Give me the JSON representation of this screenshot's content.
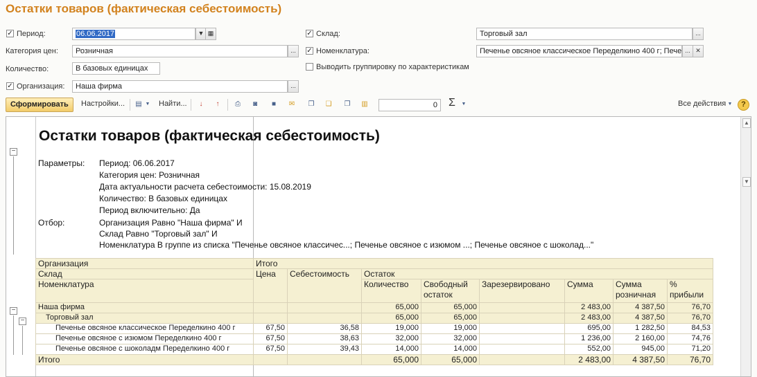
{
  "title": "Остатки товаров (фактическая себестоимость)",
  "form": {
    "period_label": "Период:",
    "period_value": "06.06.2017",
    "price_category_label": "Категория цен:",
    "price_category_value": "Розничная",
    "quantity_label": "Количество:",
    "quantity_value": "В базовых единицах",
    "organization_label": "Организация:",
    "organization_value": "Наша фирма",
    "warehouse_label": "Склад:",
    "warehouse_value": "Торговый зал",
    "nomenclature_label": "Номенклатура:",
    "nomenclature_value": "Печенье овсяное классическое Переделкино 400 г; Пече",
    "group_by_chars_label": "Выводить группировку по характеристикам"
  },
  "toolbar": {
    "generate": "Сформировать",
    "settings": "Настройки...",
    "find": "Найти...",
    "number_value": "0",
    "sigma": "Σ",
    "all_actions": "Все действия",
    "help": "?"
  },
  "report": {
    "title": "Остатки товаров (фактическая себестоимость)",
    "params_label": "Параметры:",
    "params": [
      "Период: 06.06.2017",
      "Категория цен: Розничная",
      "Дата актуальности расчета себестоимости: 15.08.2019",
      "Количество: В базовых единицах",
      "Период включительно: Да"
    ],
    "filter_label": "Отбор:",
    "filters": [
      "Организация Равно \"Наша фирма\" И",
      "Склад Равно \"Торговый зал\" И",
      "Номенклатура В группе из списка \"Печенье овсяное классичес...; Печенье овсяное с изюмом ...; Печенье овсяное с шоколад...\""
    ],
    "headers": {
      "organization": "Организация",
      "total": "Итого",
      "warehouse": "Склад",
      "price": "Цена",
      "cost": "Себестоимость",
      "balance": "Остаток",
      "nomenclature": "Номенклатура",
      "quantity": "Количество",
      "free_balance": "Свободный остаток",
      "reserved": "Зарезервировано",
      "sum": "Сумма",
      "retail_sum": "Сумма розничная",
      "profit_pct": "% прибыли"
    },
    "rows": [
      {
        "name": "Наша фирма",
        "price": "",
        "cost": "",
        "qty": "65,000",
        "free": "65,000",
        "reserved": "",
        "sum": "2 483,00",
        "retail": "4 387,50",
        "profit": "76,70"
      },
      {
        "name": "Торговый зал",
        "price": "",
        "cost": "",
        "qty": "65,000",
        "free": "65,000",
        "reserved": "",
        "sum": "2 483,00",
        "retail": "4 387,50",
        "profit": "76,70"
      },
      {
        "name": "Печенье овсяное классическое Переделкино 400 г",
        "price": "67,50",
        "cost": "36,58",
        "qty": "19,000",
        "free": "19,000",
        "reserved": "",
        "sum": "695,00",
        "retail": "1 282,50",
        "profit": "84,53"
      },
      {
        "name": "Печенье овсяное с изюмом Переделкино 400 г",
        "price": "67,50",
        "cost": "38,63",
        "qty": "32,000",
        "free": "32,000",
        "reserved": "",
        "sum": "1 236,00",
        "retail": "2 160,00",
        "profit": "74,76"
      },
      {
        "name": "Печенье овсяное с шоколадм Переделкино 400 г",
        "price": "67,50",
        "cost": "39,43",
        "qty": "14,000",
        "free": "14,000",
        "reserved": "",
        "sum": "552,00",
        "retail": "945,00",
        "profit": "71,20"
      }
    ],
    "total_row": {
      "name": "Итого",
      "qty": "65,000",
      "free": "65,000",
      "sum": "2 483,00",
      "retail": "4 387,50",
      "profit": "76,70"
    }
  }
}
